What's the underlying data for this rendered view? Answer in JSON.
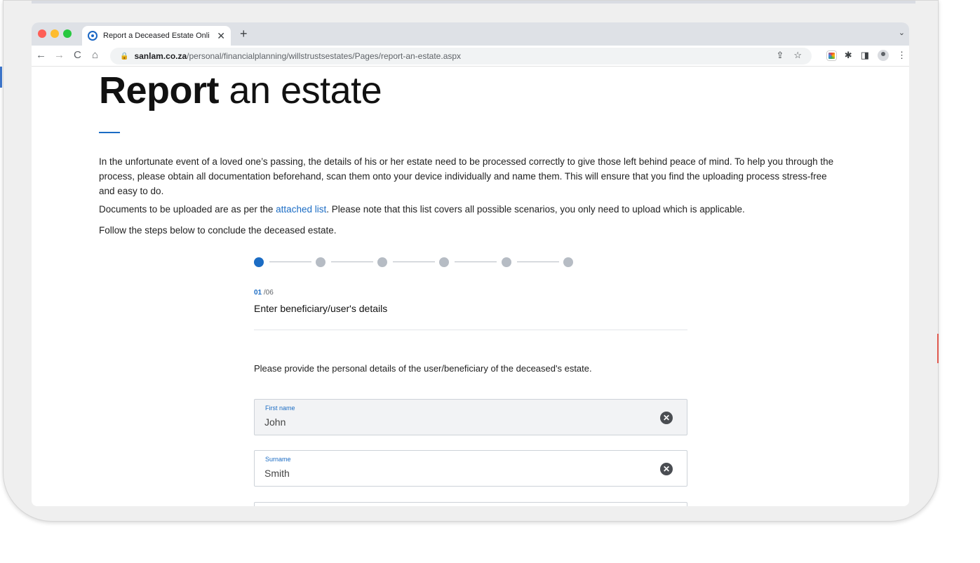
{
  "browser": {
    "tab": {
      "title": "Report a Deceased Estate Onli",
      "close": "✕"
    },
    "new_tab": "+",
    "tab_chevron": "⌄",
    "nav": {
      "back": "←",
      "forward": "→",
      "reload": "C",
      "home": "⌂"
    },
    "url": {
      "lock": "🔒",
      "host": "sanlam.co.za",
      "path": "/personal/financialplanning/willstrustsestates/Pages/report-an-estate.aspx"
    },
    "omni_icons": {
      "share": "⇪",
      "bookmark": "☆"
    },
    "ext_icons": {
      "puzzle": "✱",
      "sidepanel": "◨",
      "menu": "⋮"
    }
  },
  "page": {
    "heading_bold": "Report",
    "heading_light": " an estate",
    "intro": "In the unfortunate event of a loved one’s passing, the details of his or her estate need to be processed correctly to give those left behind peace of mind. To help you through the process, please obtain all documentation beforehand, scan them onto your device individually and name them. This will ensure that you find the uploading process stress-free and easy to do.",
    "docs_prefix": "Documents to be uploaded are as per the ",
    "docs_link": "attached list",
    "docs_suffix": ". Please note that this list covers all possible scenarios, you only need to upload which is applicable.",
    "follow": "Follow the steps below to conclude the deceased estate.",
    "stepper": {
      "total_steps": 6,
      "active_step": 1
    },
    "step_current": "01",
    "step_total": " /06",
    "step_title": "Enter beneficiary/user's details",
    "instruction": "Please provide the personal details of the user/beneficiary of the deceased's estate.",
    "fields": {
      "first_name": {
        "label": "First name",
        "value": "John",
        "clear": "✕"
      },
      "surname": {
        "label": "Surname",
        "value": "Smith",
        "clear": "✕"
      }
    }
  },
  "colors": {
    "accent": "#1b6cc4",
    "step_inactive": "#b6bcc4"
  }
}
